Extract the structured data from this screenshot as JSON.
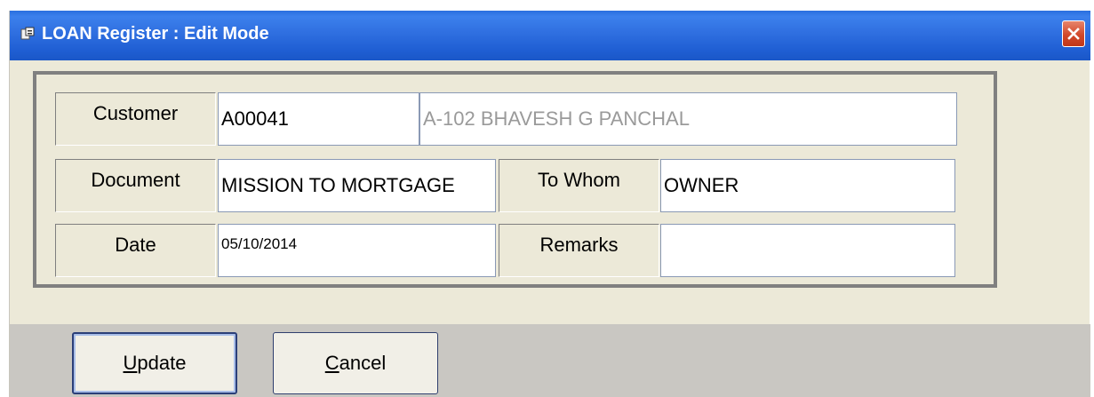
{
  "window": {
    "title": "LOAN Register : Edit Mode",
    "icon": "app-icon",
    "close_icon": "close-icon"
  },
  "form": {
    "customer_label": "Customer",
    "customer_code": "A00041",
    "customer_name": "A-102 BHAVESH G PANCHAL",
    "document_label": "Document",
    "document_value": "MISSION TO MORTGAGE",
    "to_whom_label": "To Whom",
    "to_whom_value": "OWNER",
    "date_label": "Date",
    "date_value": "05/10/2014",
    "remarks_label": "Remarks",
    "remarks_value": ""
  },
  "buttons": {
    "update_first": "U",
    "update_rest": "pdate",
    "cancel_first": "C",
    "cancel_rest": "ancel"
  },
  "colors": {
    "titlebar": "#2562d8",
    "window_bg": "#ece9d8",
    "button_band": "#c9c7c2",
    "close_button": "#d2482a"
  }
}
